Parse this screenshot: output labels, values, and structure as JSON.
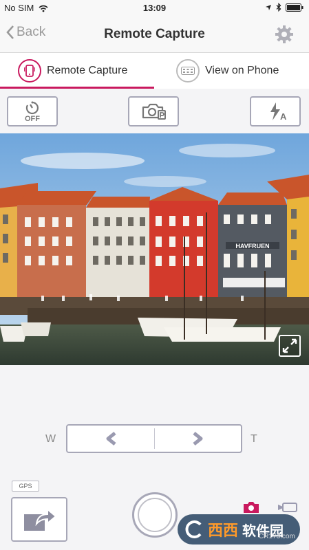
{
  "status": {
    "carrier": "No SIM",
    "time": "13:09"
  },
  "nav": {
    "back_label": "Back",
    "title": "Remote Capture"
  },
  "tabs": [
    {
      "label": "Remote Capture",
      "icon": "phone-icon",
      "active": true
    },
    {
      "label": "View on Phone",
      "icon": "grid-icon",
      "active": false
    }
  ],
  "controls": {
    "timer_label": "OFF",
    "flash_mode": "A"
  },
  "zoom": {
    "wide_label": "W",
    "tele_label": "T"
  },
  "gps_label": "GPS",
  "watermark": {
    "brand_orange": "西西",
    "brand_white": "软件园",
    "url": "CR173.com"
  },
  "colors": {
    "accent": "#c9195e",
    "control_border": "#a7a7b7"
  }
}
